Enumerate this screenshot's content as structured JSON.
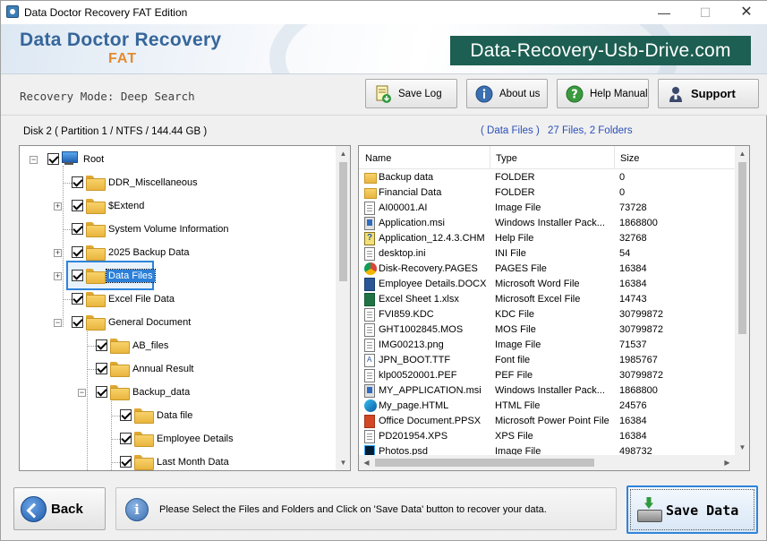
{
  "window": {
    "title": "Data Doctor Recovery FAT Edition",
    "min_glyph": "—",
    "max_glyph": "☐",
    "close_glyph": "✕"
  },
  "banner": {
    "brand_main": "Data Doctor Recovery",
    "brand_sub": "FAT",
    "site": "Data-Recovery-Usb-Drive.com"
  },
  "mode": {
    "text": "Recovery Mode: Deep Search"
  },
  "toolbar": {
    "save_log": "Save Log",
    "about_us": "About us",
    "help_manual": "Help Manual",
    "support": "Support"
  },
  "disk_info": "Disk 2 ( Partition 1 / NTFS / 144.44 GB )",
  "files_info": {
    "section": "( Data Files )",
    "counts": "27 Files, 2 Folders"
  },
  "tree": [
    {
      "label": "Root",
      "icon": "computer-icon"
    },
    {
      "label": "DDR_Miscellaneous"
    },
    {
      "label": "$Extend"
    },
    {
      "label": "System Volume Information"
    },
    {
      "label": "2025 Backup Data"
    },
    {
      "label": "Data Files",
      "selected": true
    },
    {
      "label": "Excel File Data"
    },
    {
      "label": "General Document"
    },
    {
      "label": "AB_files"
    },
    {
      "label": "Annual Result"
    },
    {
      "label": "Backup_data"
    },
    {
      "label": "Data file"
    },
    {
      "label": "Employee Details"
    },
    {
      "label": "Last Month Data"
    }
  ],
  "list": {
    "headers": [
      "Name",
      "Type",
      "Size"
    ],
    "rows": [
      {
        "name": "Backup data",
        "type": "FOLDER",
        "size": "0",
        "icon": "folder-icon"
      },
      {
        "name": "Financial Data",
        "type": "FOLDER",
        "size": "0",
        "icon": "folder-icon"
      },
      {
        "name": "AI00001.AI",
        "type": "Image File",
        "size": "73728",
        "icon": "document-icon"
      },
      {
        "name": "Application.msi",
        "type": "Windows Installer Pack...",
        "size": "1868800",
        "icon": "installer-icon"
      },
      {
        "name": "Application_12.4.3.CHM",
        "type": "Help File",
        "size": "32768",
        "icon": "help-file-icon"
      },
      {
        "name": "desktop.ini",
        "type": "INI File",
        "size": "54",
        "icon": "document-icon"
      },
      {
        "name": "Disk-Recovery.PAGES",
        "type": "PAGES File",
        "size": "16384",
        "icon": "chrome-icon"
      },
      {
        "name": "Employee Details.DOCX",
        "type": "Microsoft Word File",
        "size": "16384",
        "icon": "word-icon"
      },
      {
        "name": "Excel Sheet 1.xlsx",
        "type": "Microsoft Excel File",
        "size": "14743",
        "icon": "excel-icon"
      },
      {
        "name": "FVI859.KDC",
        "type": "KDC File",
        "size": "30799872",
        "icon": "document-icon"
      },
      {
        "name": "GHT1002845.MOS",
        "type": "MOS File",
        "size": "30799872",
        "icon": "document-icon"
      },
      {
        "name": "IMG00213.png",
        "type": "Image File",
        "size": "71537",
        "icon": "document-icon"
      },
      {
        "name": "JPN_BOOT.TTF",
        "type": "Font file",
        "size": "1985767",
        "icon": "font-icon"
      },
      {
        "name": "klp00520001.PEF",
        "type": "PEF File",
        "size": "30799872",
        "icon": "document-icon"
      },
      {
        "name": "MY_APPLICATION.msi",
        "type": "Windows Installer Pack...",
        "size": "1868800",
        "icon": "installer-icon"
      },
      {
        "name": "My_page.HTML",
        "type": "HTML File",
        "size": "24576",
        "icon": "edge-icon"
      },
      {
        "name": "Office Document.PPSX",
        "type": "Microsoft Power Point File",
        "size": "16384",
        "icon": "powerpoint-icon"
      },
      {
        "name": "PD201954.XPS",
        "type": "XPS File",
        "size": "16384",
        "icon": "document-icon"
      },
      {
        "name": "Photos.psd",
        "type": "Image File",
        "size": "498732",
        "icon": "photoshop-icon"
      }
    ]
  },
  "bottom": {
    "back": "Back",
    "message": "Please Select the Files and Folders and Click on 'Save Data' button to recover your data.",
    "save_data": "Save Data"
  },
  "colors": {
    "brand_blue": "#36669b",
    "brand_orange": "#e58a2c",
    "site_badge": "#1d5f52",
    "link_blue": "#2b4fb8",
    "selection": "#2b7fd8"
  }
}
